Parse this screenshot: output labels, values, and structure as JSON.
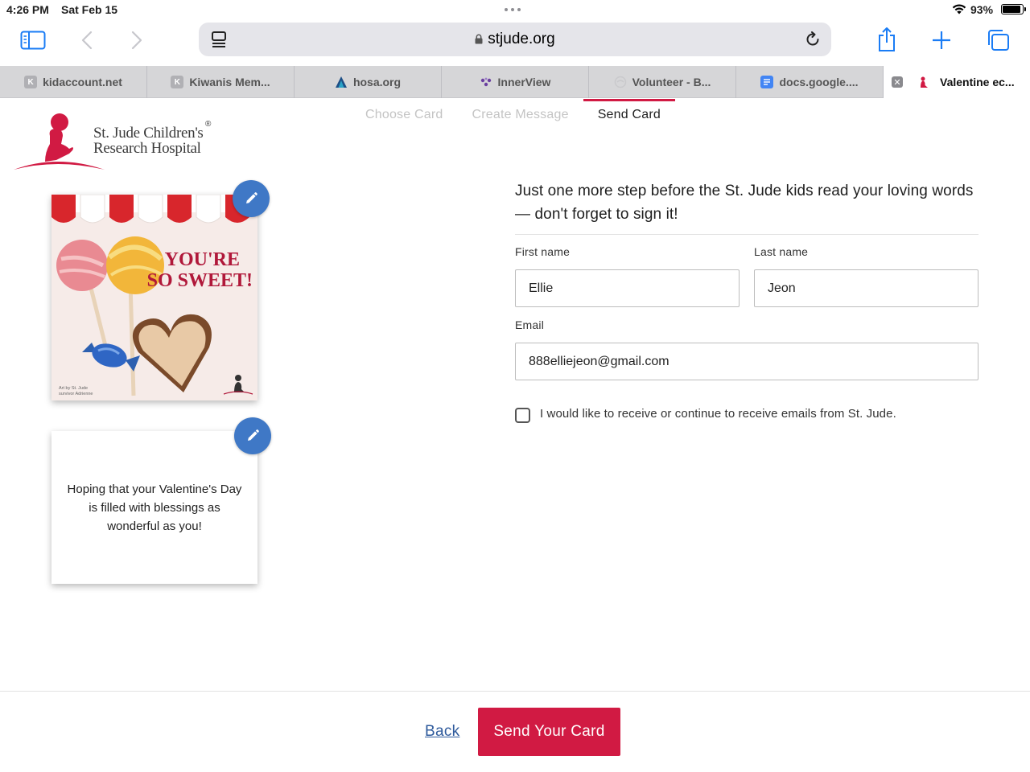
{
  "status": {
    "time": "4:26 PM",
    "date": "Sat Feb 15",
    "battery_pct": "93%",
    "battery_level": 0.93
  },
  "browser": {
    "url": "stjude.org",
    "icons": [
      "sidebar-icon",
      "back-icon",
      "forward-icon",
      "tab-overview-icon",
      "lock-icon",
      "reload-icon",
      "share-icon",
      "new-tab-icon",
      "tabs-icon"
    ]
  },
  "tabs": [
    {
      "label": "kidaccount.net",
      "favicon": "K"
    },
    {
      "label": "Kiwanis Mem...",
      "favicon": "K"
    },
    {
      "label": "hosa.org",
      "favicon": "hosa"
    },
    {
      "label": "InnerView",
      "favicon": "innerview"
    },
    {
      "label": "Volunteer - B...",
      "favicon": "volunteer"
    },
    {
      "label": "docs.google....",
      "favicon": "docs"
    },
    {
      "label": "Valentine ec...",
      "favicon": "stjude"
    }
  ],
  "site": {
    "logo_line1": "St. Jude Children's",
    "logo_line2": "Research Hospital",
    "logo_reg": "®",
    "steps": [
      "Choose Card",
      "Create Message",
      "Send Card"
    ],
    "current_step": "Send Card"
  },
  "card": {
    "front_text_1": "YOU'RE",
    "front_text_2": "SO SWEET!",
    "art_credit_1": "Art by St. Jude",
    "art_credit_2": "survivor Adrienne",
    "message": "Hoping that your Valentine's Day is filled with blessings as wonderful as you!"
  },
  "form": {
    "headline": "Just one more step before the St. Jude kids read your loving words — don't forget to sign it!",
    "first_name_label": "First name",
    "first_name_value": "Ellie",
    "last_name_label": "Last name",
    "last_name_value": "Jeon",
    "email_label": "Email",
    "email_value": "888elliejeon@gmail.com",
    "optin_label": "I would like to receive or continue to receive emails from St. Jude.",
    "optin_checked": false
  },
  "footer": {
    "back_label": "Back",
    "send_label": "Send Your Card"
  },
  "colors": {
    "brand_red": "#d11a43",
    "edit_blue": "#3f78c6",
    "link_blue": "#2e5a9c",
    "safari_blue": "#1a7cf5"
  }
}
